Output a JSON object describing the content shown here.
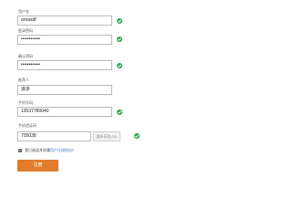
{
  "form": {
    "username": {
      "label": "用户名",
      "value": "oroasdf",
      "valid": true
    },
    "password": {
      "label": "登录密码",
      "value": "••••••••••••",
      "valid": true
    },
    "confirm_password": {
      "label": "确认密码",
      "value": "••••••••••••",
      "valid": true
    },
    "referrer": {
      "label": "推荐人",
      "value": "浪多",
      "valid": false
    },
    "phone": {
      "label": "手机号码",
      "value": "13537780040",
      "valid": true
    },
    "sms_code": {
      "label": "手机验证码",
      "value": "705038",
      "valid": true
    }
  },
  "sms_button": {
    "label": "重新获取(38)"
  },
  "agreement": {
    "checked": true,
    "text": "我已阅读并同意",
    "link": "《用户注册协议》"
  },
  "submit": {
    "label": "注册"
  },
  "colors": {
    "accent": "#e07c2b",
    "valid": "#2aa55a",
    "link": "#3a75c4"
  },
  "icons": {
    "valid": "check-circle-icon",
    "agree": "checkbox-checked-icon"
  }
}
